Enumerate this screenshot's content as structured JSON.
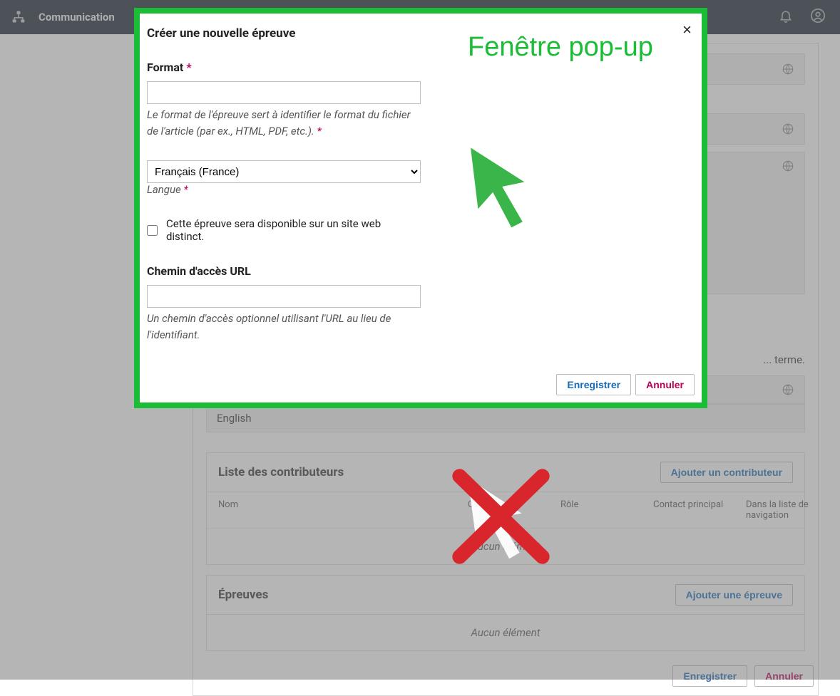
{
  "topbar": {
    "title": "Communication"
  },
  "background": {
    "keywords_hint": "... terme.",
    "lang_field_value": "English",
    "contributors": {
      "title": "Liste des contributeurs",
      "add_btn": "Ajouter un contributeur",
      "col_name": "Nom",
      "col_contact": "Co",
      "col_role": "Rôle",
      "col_primary": "Contact principal",
      "col_browse": "Dans la liste de navigation",
      "empty": "Aucun élément"
    },
    "galleys": {
      "title": "Épreuves",
      "add_btn": "Ajouter une épreuve",
      "empty": "Aucun élément"
    },
    "save": "Enregistrer",
    "cancel": "Annuler"
  },
  "modal": {
    "title": "Créer une nouvelle épreuve",
    "annotation": "Fenêtre pop-up",
    "format_label": "Format",
    "format_value": "",
    "format_help": "Le format de l'épreuve sert à identifier le format du fichier de l'article (par ex., HTML, PDF, etc.).",
    "language_selected": "Français (France)",
    "language_label": "Langue",
    "distinct_checkbox": "Cette épreuve sera disponible sur un site web distinct.",
    "url_label": "Chemin d'accès URL",
    "url_value": "",
    "url_help": "Un chemin d'accès optionnel utilisant l'URL au lieu de l'identifiant.",
    "save": "Enregistrer",
    "cancel": "Annuler"
  }
}
